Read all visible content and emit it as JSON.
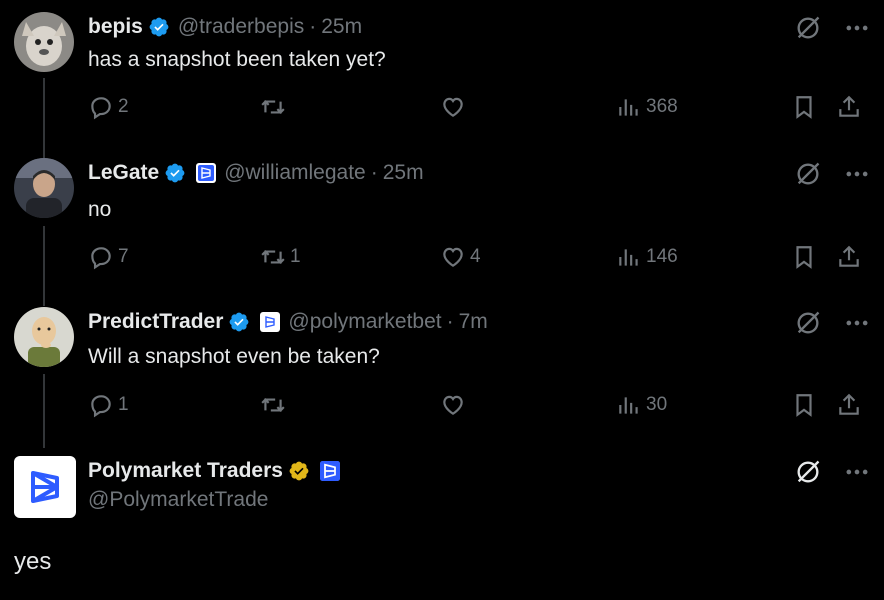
{
  "tweets": [
    {
      "name": "bepis",
      "handle": "@traderbepis",
      "time": "25m",
      "text": "has a snapshot been taken yet?",
      "replies": "2",
      "reposts": "",
      "likes": "",
      "views": "368",
      "verified": "blue",
      "affiliate": false
    },
    {
      "name": "LeGate",
      "handle": "@williamlegate",
      "time": "25m",
      "text": "no",
      "replies": "7",
      "reposts": "1",
      "likes": "4",
      "views": "146",
      "verified": "blue",
      "affiliate": true
    },
    {
      "name": "PredictTrader",
      "handle": "@polymarketbet",
      "time": "7m",
      "text": "Will a snapshot even be taken?",
      "replies": "1",
      "reposts": "",
      "likes": "",
      "views": "30",
      "verified": "blue",
      "affiliate": true
    }
  ],
  "main": {
    "name": "Polymarket Traders",
    "handle": "@PolymarketTrade",
    "text": "yes",
    "verified": "gold",
    "affiliate": true
  },
  "colors": {
    "background": "#000000",
    "text": "#e7e9ea",
    "muted": "#71767b",
    "verified_blue": "#1d9bf0",
    "verified_gold": "#e2b719",
    "thread_line": "#333639",
    "polymarket_blue": "#2e5cff"
  },
  "icons": [
    "reply-icon",
    "repost-icon",
    "like-icon",
    "views-icon",
    "bookmark-icon",
    "share-icon",
    "grok-icon",
    "more-icon",
    "verified-badge-icon",
    "polymarket-affiliate-icon"
  ]
}
